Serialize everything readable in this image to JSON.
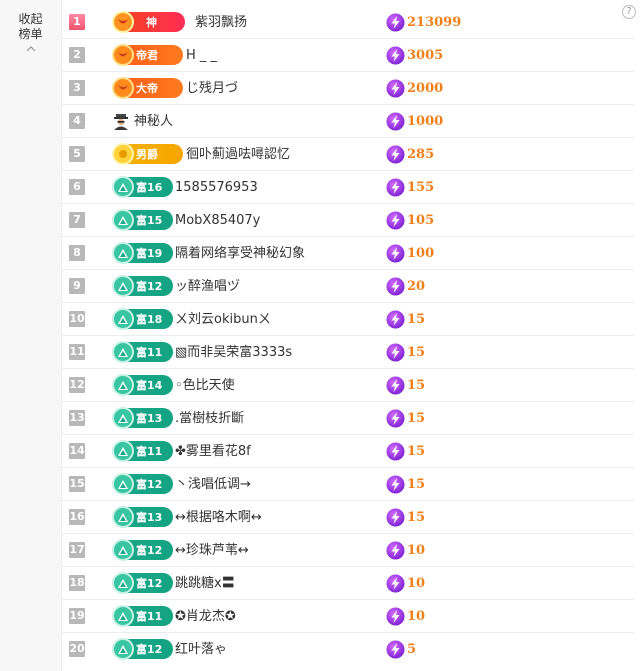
{
  "sidebar": {
    "collapse_label": "收起榜单",
    "help_glyph": "?"
  },
  "leaderboard": [
    {
      "rank": "1",
      "badge_type": "god",
      "badge_label": "神",
      "name": "紫羽飘扬",
      "score": "213099"
    },
    {
      "rank": "2",
      "badge_type": "emp",
      "badge_label": "帝君",
      "name": "H _ _",
      "score": "3005"
    },
    {
      "rank": "3",
      "badge_type": "emp",
      "badge_label": "大帝",
      "name": "じ残月づ",
      "score": "2000"
    },
    {
      "rank": "4",
      "badge_type": "mystery",
      "badge_label": "",
      "name": "神秘人",
      "score": "1000"
    },
    {
      "rank": "5",
      "badge_type": "duke",
      "badge_label": "男爵",
      "name": "徊卟薊過呿噚認忆",
      "score": "285"
    },
    {
      "rank": "6",
      "badge_type": "rich",
      "badge_label": "富16",
      "name": "1585576953",
      "score": "155"
    },
    {
      "rank": "7",
      "badge_type": "rich",
      "badge_label": "富15",
      "name": "MobX85407y",
      "score": "105"
    },
    {
      "rank": "8",
      "badge_type": "rich",
      "badge_label": "富19",
      "name": "隔着网络享受神秘幻象",
      "score": "100"
    },
    {
      "rank": "9",
      "badge_type": "rich",
      "badge_label": "富12",
      "name": "ッ醉渔唱ヅ",
      "score": "20"
    },
    {
      "rank": "10",
      "badge_type": "rich",
      "badge_label": "富18",
      "name": "ㄨ刘云okibunㄨ",
      "score": "15"
    },
    {
      "rank": "11",
      "badge_type": "rich",
      "badge_label": "富11",
      "name": "▧而非吴荣富3333s",
      "score": "15"
    },
    {
      "rank": "12",
      "badge_type": "rich",
      "badge_label": "富14",
      "name": "◦色比天使",
      "score": "15"
    },
    {
      "rank": "13",
      "badge_type": "rich",
      "badge_label": "富13",
      "name": ".當樹枝折斷",
      "score": "15"
    },
    {
      "rank": "14",
      "badge_type": "rich",
      "badge_label": "富11",
      "name": "✤雾里看花8f",
      "score": "15"
    },
    {
      "rank": "15",
      "badge_type": "rich",
      "badge_label": "富12",
      "name": "丶浅唱低调→",
      "score": "15"
    },
    {
      "rank": "16",
      "badge_type": "rich",
      "badge_label": "富13",
      "name": "↔根据咯木啊↔",
      "score": "15"
    },
    {
      "rank": "17",
      "badge_type": "rich",
      "badge_label": "富12",
      "name": "↔珍珠芦苇↔",
      "score": "10"
    },
    {
      "rank": "18",
      "badge_type": "rich",
      "badge_label": "富12",
      "name": "跳跳糖x〓",
      "score": "10"
    },
    {
      "rank": "19",
      "badge_type": "rich",
      "badge_label": "富11",
      "name": "✪肖龙杰✪",
      "score": "10"
    },
    {
      "rank": "20",
      "badge_type": "rich",
      "badge_label": "富12",
      "name": "红叶落ゃ",
      "score": "5"
    }
  ]
}
